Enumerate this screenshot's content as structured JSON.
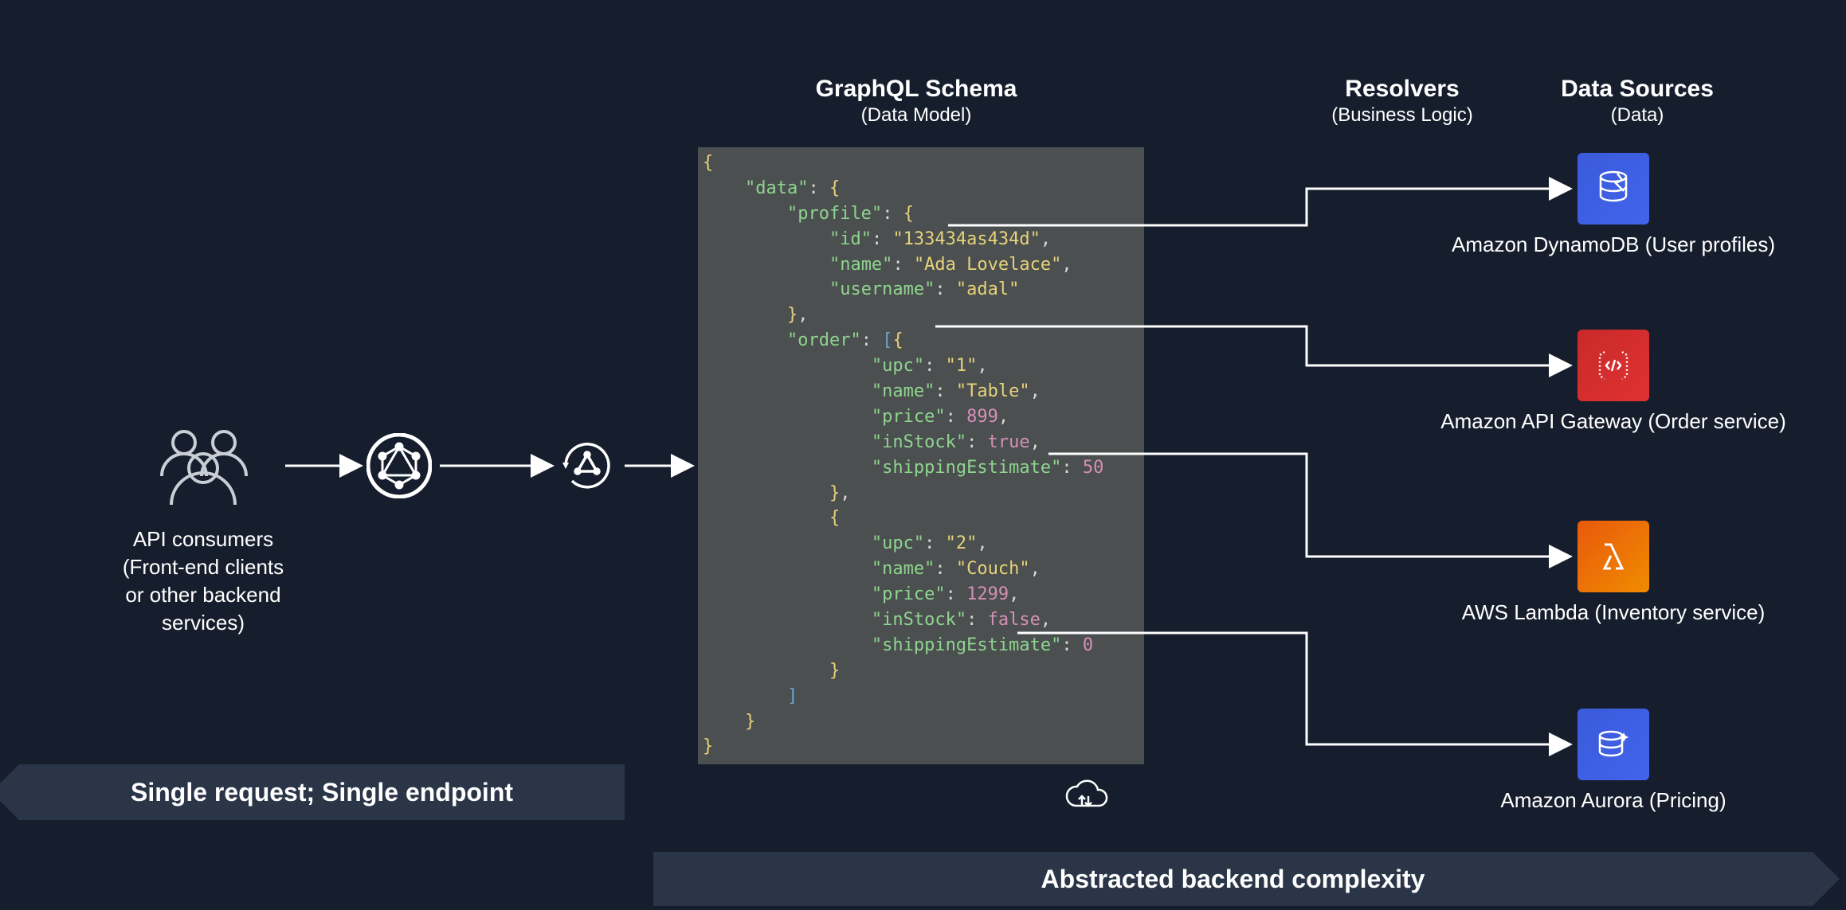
{
  "columns": {
    "schema": {
      "title": "GraphQL Schema",
      "sub": "(Data Model)"
    },
    "resolvers": {
      "title": "Resolvers",
      "sub": "(Business Logic)"
    },
    "datasources": {
      "title": "Data Sources",
      "sub": "(Data)"
    }
  },
  "consumers": {
    "label": "API consumers\n(Front-end clients\nor other backend\nservices)"
  },
  "banners": {
    "left": "Single request; Single endpoint",
    "right": "Abstracted backend complexity"
  },
  "code": {
    "data": {
      "profile": {
        "id": "133434as434d",
        "name": "Ada Lovelace",
        "username": "adal"
      },
      "order": [
        {
          "upc": "1",
          "name": "Table",
          "price": 899,
          "inStock": true,
          "shippingEstimate": 50
        },
        {
          "upc": "2",
          "name": "Couch",
          "price": 1299,
          "inStock": false,
          "shippingEstimate": 0
        }
      ]
    }
  },
  "services": {
    "ddb": {
      "label": "Amazon DynamoDB (User profiles)"
    },
    "apigw": {
      "label": "Amazon API Gateway (Order service)"
    },
    "lambda": {
      "label": "AWS Lambda (Inventory service)"
    },
    "aurora": {
      "label": "Amazon Aurora (Pricing)"
    }
  }
}
